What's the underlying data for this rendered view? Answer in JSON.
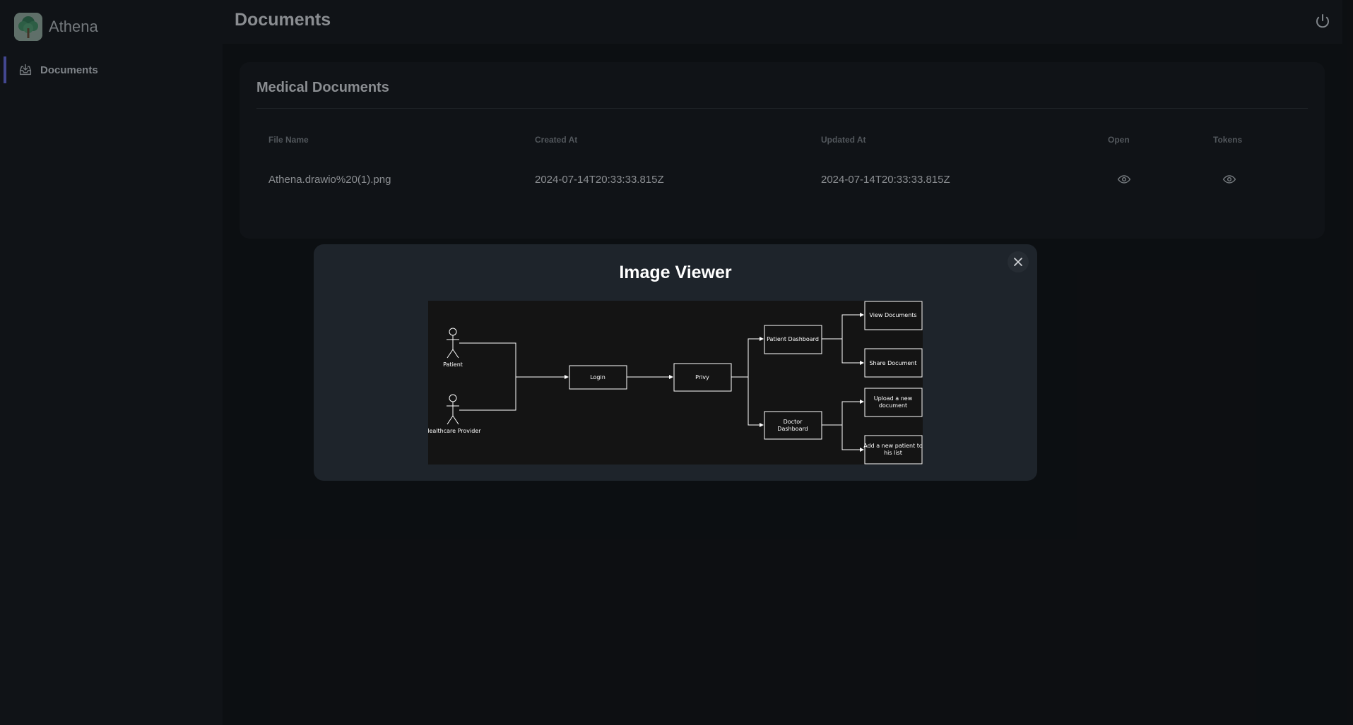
{
  "app": {
    "name": "Athena"
  },
  "sidebar": {
    "items": [
      {
        "label": "Documents",
        "icon": "inbox-download-icon",
        "active": true
      }
    ]
  },
  "header": {
    "title": "Documents",
    "logout_icon": "power-icon"
  },
  "card": {
    "title": "Medical Documents",
    "columns": [
      "File Name",
      "Created At",
      "Updated At",
      "Open",
      "Tokens"
    ],
    "rows": [
      {
        "file_name": "Athena.drawio%20(1).png",
        "created_at": "2024-07-14T20:33:33.815Z",
        "updated_at": "2024-07-14T20:33:33.815Z",
        "open_icon": "eye-icon",
        "tokens_icon": "eye-icon"
      }
    ]
  },
  "modal": {
    "title": "Image Viewer",
    "close_icon": "close-icon",
    "diagram": {
      "actor_patient": "Patient",
      "actor_provider": "Healthcare Provider",
      "login": "Login",
      "privy": "Privy",
      "patient_dashboard": "Patient Dashboard",
      "doctor_dashboard_1": "Doctor",
      "doctor_dashboard_2": "Dashboard",
      "view_documents": "View Documents",
      "share_document": "Share Document",
      "upload_1": "Upload a new",
      "upload_2": "document",
      "add_patient_1": "Add  a new patient to",
      "add_patient_2": "his list"
    }
  },
  "colors": {
    "background": "#111418",
    "surface": "#161a1f",
    "modal": "#1e242b",
    "accent": "#5a5fc0"
  }
}
